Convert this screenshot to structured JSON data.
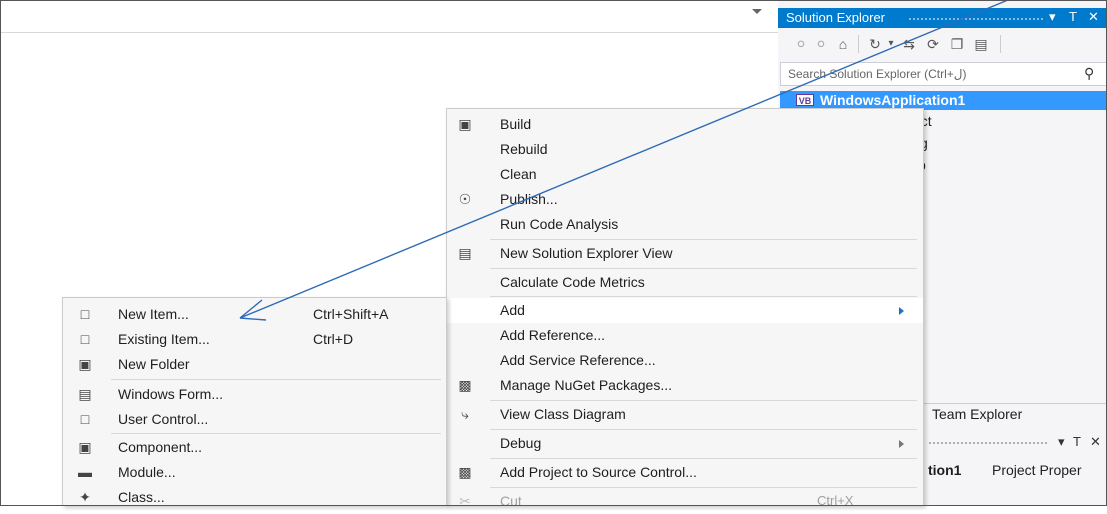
{
  "solution_explorer": {
    "title": "Solution Explorer",
    "pin_glyph": "↓ Т",
    "close_glyph": "✕",
    "toolbar_icons": [
      "back-icon",
      "forward-icon",
      "home-icon",
      "history-icon",
      "sync-icon",
      "refresh-icon",
      "collapse-icon",
      "properties-icon"
    ],
    "search_placeholder": "Search Solution Explorer (Ctrl+ل)",
    "root_item": "WindowsApplication1",
    "vb_badge": "VB",
    "partial_items": [
      "ect",
      "fig",
      "b"
    ]
  },
  "team_tab": "Team Explorer",
  "properties": {
    "header_bold": "tion1",
    "header_rest": "Project Proper",
    "pin_glyph": "▾ Т ✕"
  },
  "context_menu": {
    "items": [
      {
        "label": "Build",
        "icon": "build-icon"
      },
      {
        "label": "Rebuild"
      },
      {
        "label": "Clean"
      },
      {
        "label": "Publish...",
        "icon": "publish-icon"
      },
      {
        "label": "Run Code Analysis"
      },
      {
        "label": "New Solution Explorer View",
        "icon": "new-view-icon"
      },
      {
        "label": "Calculate Code Metrics"
      },
      {
        "label": "Add",
        "submenu": true
      },
      {
        "label": "Add Reference..."
      },
      {
        "label": "Add Service Reference..."
      },
      {
        "label": "Manage NuGet Packages...",
        "icon": "nuget-icon"
      },
      {
        "label": "View Class Diagram",
        "icon": "class-diagram-icon"
      },
      {
        "label": "Debug",
        "submenu": true
      },
      {
        "label": "Add Project to Source Control...",
        "icon": "source-control-icon"
      },
      {
        "label": "Cut",
        "shortcut": "Ctrl+X",
        "disabled": true
      }
    ]
  },
  "add_submenu": {
    "items": [
      {
        "label": "New Item...",
        "shortcut": "Ctrl+Shift+A",
        "icon": "new-item-icon"
      },
      {
        "label": "Existing Item...",
        "shortcut": "Ctrl+D",
        "icon": "existing-item-icon"
      },
      {
        "label": "New Folder",
        "icon": "new-folder-icon"
      },
      {
        "label": "Windows Form...",
        "icon": "windows-form-icon"
      },
      {
        "label": "User Control...",
        "icon": "user-control-icon"
      },
      {
        "label": "Component...",
        "icon": "component-icon"
      },
      {
        "label": "Module...",
        "icon": "module-icon"
      },
      {
        "label": "Class...",
        "icon": "class-icon"
      }
    ]
  },
  "colors": {
    "accent": "#007acc",
    "selection": "#3399ff",
    "annotation_arrow": "#2e6bb8"
  }
}
